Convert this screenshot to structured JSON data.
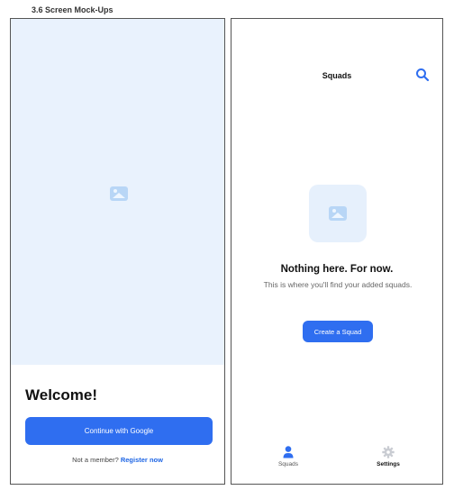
{
  "page": {
    "heading": "3.6 Screen Mock-Ups"
  },
  "welcome_screen": {
    "title": "Welcome!",
    "continue_button": "Continue with Google",
    "member_prompt": "Not a member?",
    "register_link": "Register now",
    "hero_icon": "image-placeholder-icon"
  },
  "squads_screen": {
    "title": "Squads",
    "search_icon": "search-icon",
    "empty_state": {
      "icon": "image-placeholder-icon",
      "title": "Nothing here. For now.",
      "description": "This is where you'll find your added squads."
    },
    "create_button": "Create a Squad",
    "tabs": [
      {
        "label": "Squads",
        "icon": "person-icon",
        "color": "#2f6ef0"
      },
      {
        "label": "Settings",
        "icon": "gear-icon",
        "color": "#c9ccd2"
      }
    ]
  },
  "colors": {
    "accent": "#2f6ef0",
    "link": "#1f66e5",
    "hero_bg": "#e9f2fd"
  }
}
